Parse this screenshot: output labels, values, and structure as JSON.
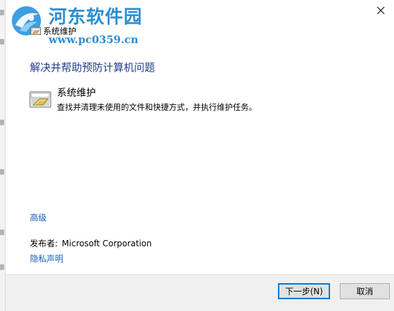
{
  "watermark": {
    "site_name": "河东软件园",
    "url": "www.pc0359.cn"
  },
  "window": {
    "title": "系统维护",
    "close_icon": "close-icon"
  },
  "content": {
    "heading": "解决并帮助预防计算机问题",
    "task": {
      "icon": "maintenance-icon",
      "title": "系统维护",
      "description": "查找并清理未使用的文件和快捷方式，并执行维护任务。"
    },
    "advanced_link": "高级",
    "publisher_label": "发布者:",
    "publisher_name": "Microsoft Corporation",
    "privacy_link": "隐私声明"
  },
  "footer": {
    "next_label": "下一步(N)",
    "cancel_label": "取消"
  },
  "colors": {
    "heading": "#1e3c8a",
    "link": "#1a5fb4",
    "watermark": "#2a8dd4",
    "footer_bg": "#f0f0f0",
    "focus_border": "#0078d7"
  }
}
